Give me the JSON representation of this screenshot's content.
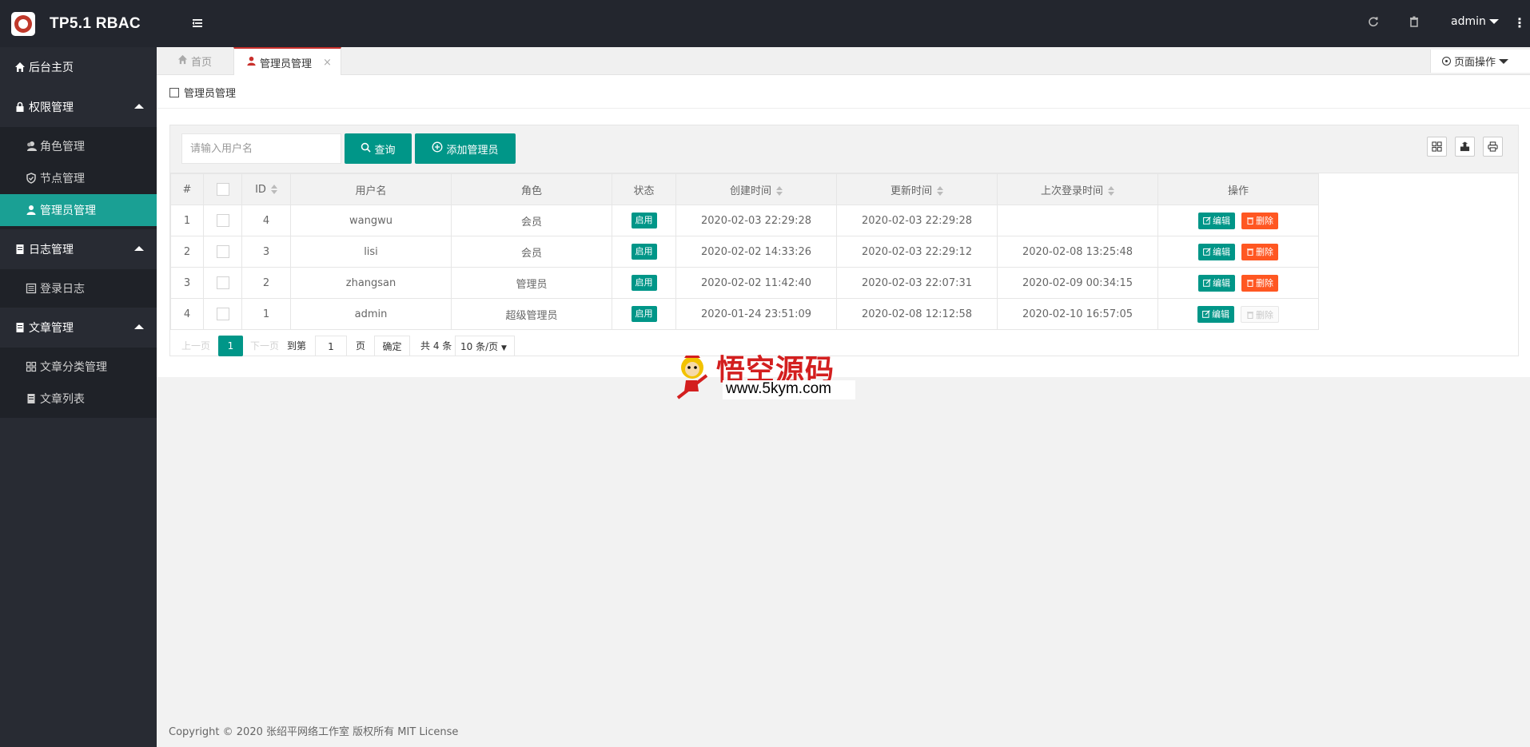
{
  "app": {
    "title": "TP5.1 RBAC",
    "user": "admin"
  },
  "icons": {
    "menu": "menu-toggle-icon",
    "refresh": "refresh-icon",
    "clear": "trash-icon",
    "more": "more-vertical-icon",
    "home": "home-icon",
    "lock": "lock-icon",
    "user": "user-icon",
    "shield": "shield-icon",
    "doc": "document-icon",
    "grid": "grid-icon",
    "search": "search-icon",
    "add": "plus-circle-icon",
    "columns": "columns-icon",
    "export": "export-icon",
    "print": "print-icon",
    "edit": "edit-icon",
    "delete": "delete-icon"
  },
  "colors": {
    "accent": "#009688",
    "sidebar": "#282b33",
    "header": "#23262e",
    "danger": "#ff5722",
    "tab_active_border": "#c9302c"
  },
  "sidebar": {
    "groups": [
      {
        "label": "后台主页",
        "children": []
      },
      {
        "label": "权限管理",
        "children": [
          {
            "label": "角色管理"
          },
          {
            "label": "节点管理"
          },
          {
            "label": "管理员管理",
            "active": true
          }
        ]
      },
      {
        "label": "日志管理",
        "children": [
          {
            "label": "登录日志"
          }
        ]
      },
      {
        "label": "文章管理",
        "children": [
          {
            "label": "文章分类管理"
          },
          {
            "label": "文章列表"
          }
        ]
      }
    ]
  },
  "tabs": {
    "home": "首页",
    "active": "管理员管理",
    "close": "×",
    "page_ops": "页面操作"
  },
  "breadcrumb": "管理员管理",
  "toolbar": {
    "search_placeholder": "请输入用户名",
    "search_value": "",
    "query": "查询",
    "add": "添加管理员"
  },
  "table": {
    "headers": [
      "#",
      "",
      "ID",
      "用户名",
      "角色",
      "状态",
      "创建时间",
      "更新时间",
      "上次登录时间",
      "操作"
    ],
    "rows": [
      {
        "num": "1",
        "id": "4",
        "username": "wangwu",
        "role": "会员",
        "status": "启用",
        "created": "2020-02-03 22:29:28",
        "updated": "2020-02-03 22:29:28",
        "last_login": "",
        "edit": "编辑",
        "delete": "删除",
        "delete_disabled": false
      },
      {
        "num": "2",
        "id": "3",
        "username": "lisi",
        "role": "会员",
        "status": "启用",
        "created": "2020-02-02 14:33:26",
        "updated": "2020-02-03 22:29:12",
        "last_login": "2020-02-08 13:25:48",
        "edit": "编辑",
        "delete": "删除",
        "delete_disabled": false
      },
      {
        "num": "3",
        "id": "2",
        "username": "zhangsan",
        "role": "管理员",
        "status": "启用",
        "created": "2020-02-02 11:42:40",
        "updated": "2020-02-03 22:07:31",
        "last_login": "2020-02-09 00:34:15",
        "edit": "编辑",
        "delete": "删除",
        "delete_disabled": false
      },
      {
        "num": "4",
        "id": "1",
        "username": "admin",
        "role": "超级管理员",
        "status": "启用",
        "created": "2020-01-24 23:51:09",
        "updated": "2020-02-08 12:12:58",
        "last_login": "2020-02-10 16:57:05",
        "edit": "编辑",
        "delete": "删除",
        "delete_disabled": true
      }
    ]
  },
  "pager": {
    "prev": "上一页",
    "current": "1",
    "next": "下一页",
    "goto": "到第",
    "page_input": "1",
    "page_unit": "页",
    "confirm": "确定",
    "total": "共 4 条",
    "per_page": "10 条/页"
  },
  "watermark": {
    "title": "悟空源码",
    "url": "www.5kym.com"
  },
  "footer": "Copyright © 2020 张绍平网络工作室 版权所有 MIT License"
}
